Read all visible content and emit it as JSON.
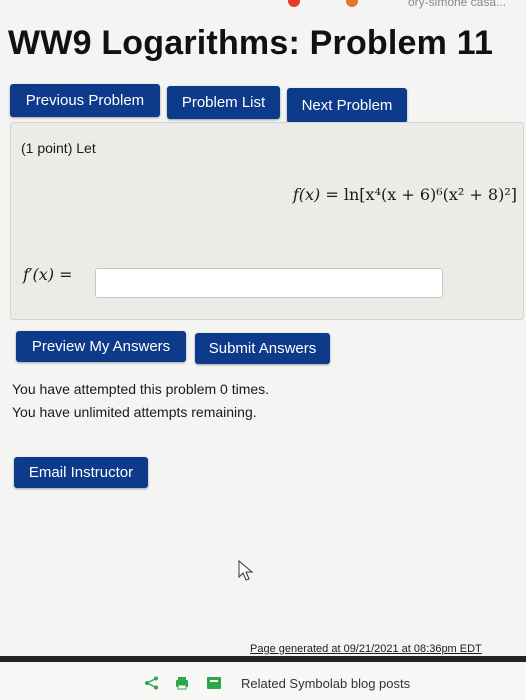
{
  "page": {
    "title": "WW9 Logarithms: Problem 11",
    "browser_tab_fragment": "ory-simone casa..."
  },
  "nav": {
    "previous": "Previous Problem",
    "list": "Problem List",
    "next": "Next Problem"
  },
  "problem": {
    "intro": "(1 point) Let",
    "function_lhs": "f(x) = ",
    "function_rhs": "ln[x⁴(x + 6)⁶(x² + 8)²]",
    "derivative_label": "f′(x) =",
    "answer_value": ""
  },
  "actions": {
    "preview": "Preview My Answers",
    "submit": "Submit Answers"
  },
  "status": {
    "attempts": "You have attempted this problem 0 times.",
    "remaining": "You have unlimited attempts remaining."
  },
  "email": "Email Instructor",
  "footer": {
    "generated": "Page generated at 09/21/2021 at 08:36pm EDT",
    "related": "Related Symbolab blog posts"
  },
  "colors": {
    "button": "#0d3a8a",
    "panel": "#ebebe8",
    "background": "#f4f4f2"
  },
  "icons": [
    "share-icon",
    "printer-icon",
    "bookmark-icon",
    "cursor-icon"
  ]
}
